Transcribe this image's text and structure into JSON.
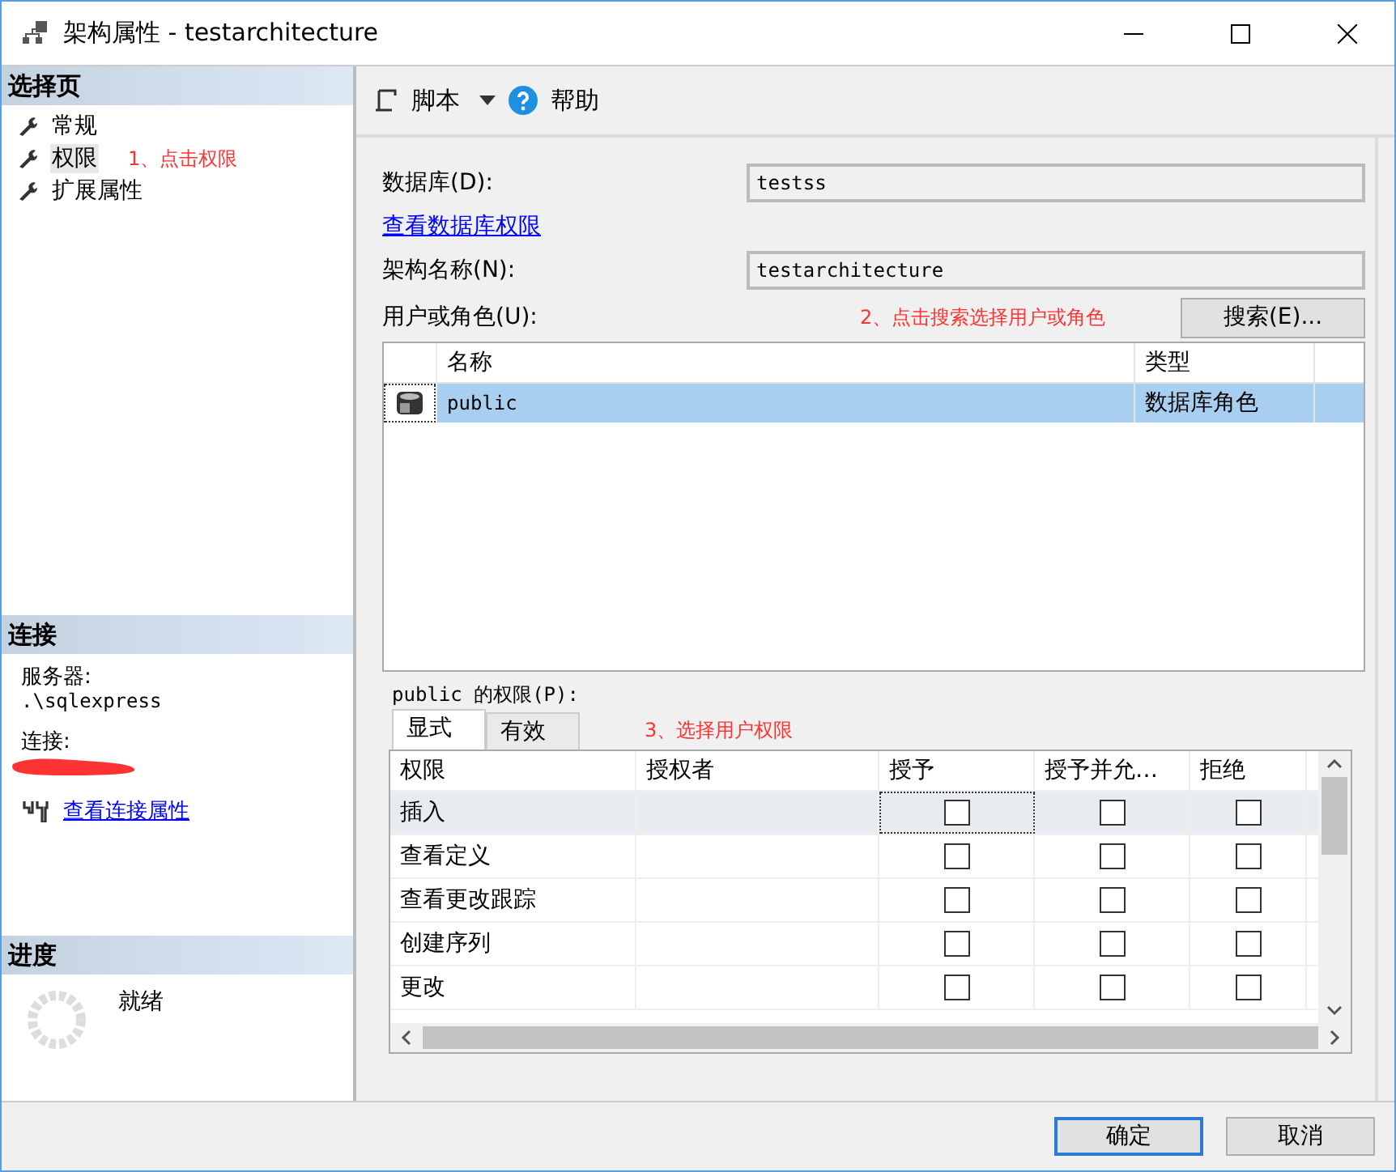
{
  "window": {
    "title": "架构属性 - testarchitecture"
  },
  "sidebar": {
    "header": "选择页",
    "items": [
      {
        "label": "常规",
        "selected": false
      },
      {
        "label": "权限",
        "selected": true
      },
      {
        "label": "扩展属性",
        "selected": false
      }
    ],
    "note": "1、点击权限"
  },
  "connection": {
    "header": "连接",
    "server_label": "服务器:",
    "server": ".\\sqlexpress",
    "connection_label": "连接:",
    "link": "查看连接属性"
  },
  "progress": {
    "header": "进度",
    "status": "就绪"
  },
  "toolbar": {
    "script": "脚本",
    "help": "帮助"
  },
  "form": {
    "database_label": "数据库(D):",
    "database": "testss",
    "db_link": "查看数据库权限",
    "schema_label": "架构名称(N):",
    "schema": "testarchitecture",
    "users_label": "用户或角色(U):",
    "note": "2、点击搜索选择用户或角色",
    "search": "搜索(E)..."
  },
  "users": {
    "columns": [
      "名称",
      "类型"
    ],
    "rows": [
      {
        "name": "public",
        "type": "数据库角色",
        "selected": true
      }
    ]
  },
  "permissions": {
    "label": "public 的权限(P):",
    "note": "3、选择用户权限",
    "tabs": [
      {
        "label": "显式",
        "selected": true
      },
      {
        "label": "有效",
        "selected": false
      }
    ],
    "columns": [
      "权限",
      "授权者",
      "授予",
      "授予并允…",
      "拒绝"
    ],
    "rows": [
      {
        "name": "插入",
        "grantor": "",
        "grant": false,
        "with_grant": false,
        "deny": false,
        "selected": true
      },
      {
        "name": "查看定义",
        "grantor": "",
        "grant": false,
        "with_grant": false,
        "deny": false,
        "selected": false
      },
      {
        "name": "查看更改跟踪",
        "grantor": "",
        "grant": false,
        "with_grant": false,
        "deny": false,
        "selected": false
      },
      {
        "name": "创建序列",
        "grantor": "",
        "grant": false,
        "with_grant": false,
        "deny": false,
        "selected": false
      },
      {
        "name": "更改",
        "grantor": "",
        "grant": false,
        "with_grant": false,
        "deny": false,
        "selected": false
      }
    ]
  },
  "buttons": [
    {
      "label": "确定",
      "kind": "default"
    },
    {
      "label": "取消",
      "kind": "normal"
    }
  ]
}
